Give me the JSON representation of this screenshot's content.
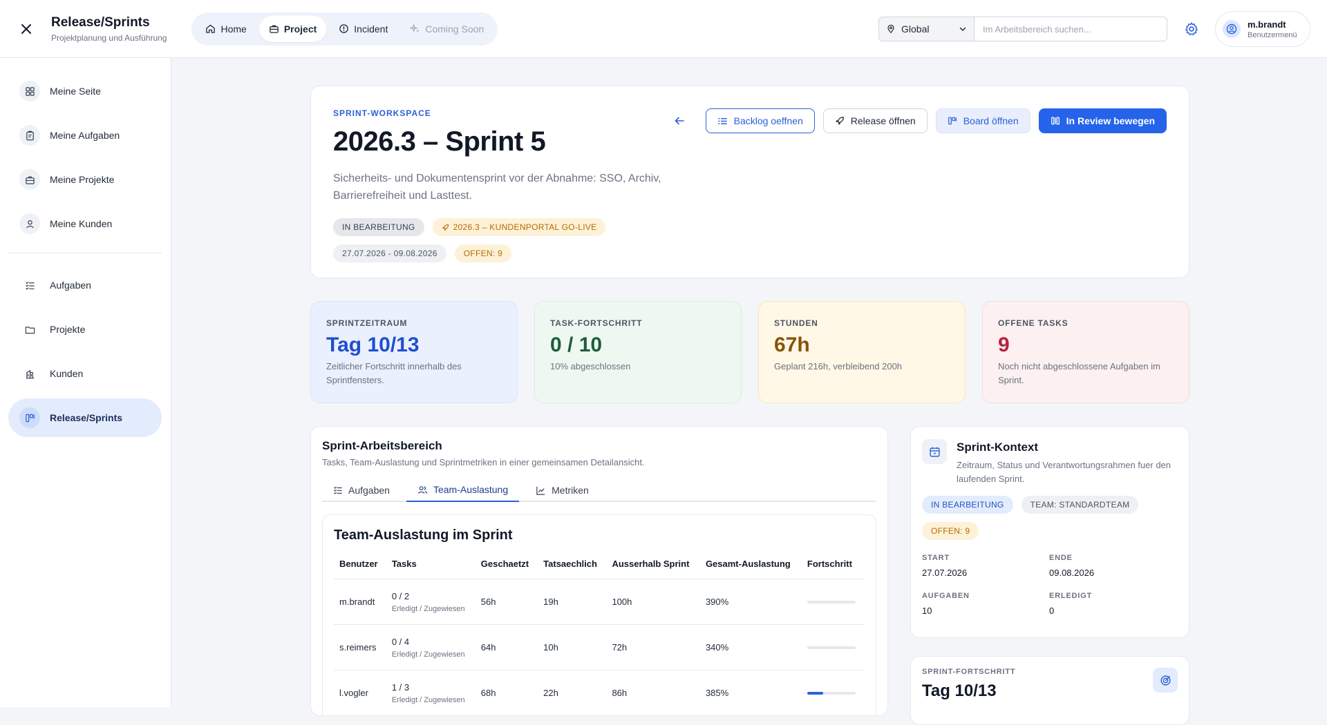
{
  "header": {
    "title": "Release/Sprints",
    "subtitle": "Projektplanung und Ausführung",
    "nav": [
      {
        "label": "Home"
      },
      {
        "label": "Project"
      },
      {
        "label": "Incident"
      },
      {
        "label": "Coming Soon"
      }
    ],
    "scope": "Global",
    "search_placeholder": "Im Arbeitsbereich suchen...",
    "user_name": "m.brandt",
    "user_sub": "Benutzermenü"
  },
  "sidebar": {
    "items": [
      {
        "label": "Meine Seite"
      },
      {
        "label": "Meine Aufgaben"
      },
      {
        "label": "Meine Projekte"
      },
      {
        "label": "Meine Kunden"
      },
      {
        "label": "Aufgaben"
      },
      {
        "label": "Projekte"
      },
      {
        "label": "Kunden"
      },
      {
        "label": "Release/Sprints"
      }
    ]
  },
  "hero": {
    "eyebrow": "SPRINT-WORKSPACE",
    "title": "2026.3 – Sprint 5",
    "description": "Sicherheits- und Dokumentensprint vor der Abnahme: SSO, Archiv, Barrierefreiheit und Lasttest.",
    "status": "IN BEARBEITUNG",
    "release": "2026.3 – KUNDENPORTAL GO-LIVE",
    "dates": "27.07.2026 - 09.08.2026",
    "open": "OFFEN: 9",
    "actions": {
      "backlog": "Backlog oeffnen",
      "release": "Release öffnen",
      "board": "Board öffnen",
      "review": "In Review bewegen"
    }
  },
  "stats": [
    {
      "label": "SPRINTZEITRAUM",
      "value": "Tag 10/13",
      "desc": "Zeitlicher Fortschritt innerhalb des Sprintfensters."
    },
    {
      "label": "TASK-FORTSCHRITT",
      "value": "0 / 10",
      "desc": "10% abgeschlossen"
    },
    {
      "label": "STUNDEN",
      "value": "67h",
      "desc": "Geplant 216h, verbleibend 200h"
    },
    {
      "label": "OFFENE TASKS",
      "value": "9",
      "desc": "Noch nicht abgeschlossene Aufgaben im Sprint."
    }
  ],
  "workarea": {
    "title": "Sprint-Arbeitsbereich",
    "subtitle": "Tasks, Team-Auslastung und Sprintmetriken in einer gemeinsamen Detailansicht.",
    "tabs": [
      {
        "label": "Aufgaben"
      },
      {
        "label": "Team-Auslastung"
      },
      {
        "label": "Metriken"
      }
    ],
    "table_title": "Team-Auslastung im Sprint",
    "columns": [
      "Benutzer",
      "Tasks",
      "Geschaetzt",
      "Tatsaechlich",
      "Ausserhalb Sprint",
      "Gesamt-Auslastung",
      "Fortschritt"
    ],
    "task_caption": "Erledigt / Zugewiesen",
    "rows": [
      {
        "user": "m.brandt",
        "tasks": "0 / 2",
        "est": "56h",
        "act": "19h",
        "outside": "100h",
        "total": "390%",
        "progress": 0
      },
      {
        "user": "s.reimers",
        "tasks": "0 / 4",
        "est": "64h",
        "act": "10h",
        "outside": "72h",
        "total": "340%",
        "progress": 0
      },
      {
        "user": "l.vogler",
        "tasks": "1 / 3",
        "est": "68h",
        "act": "22h",
        "outside": "86h",
        "total": "385%",
        "progress": 0.33
      }
    ]
  },
  "context": {
    "title": "Sprint-Kontext",
    "subtitle": "Zeitraum, Status und Verantwortungsrahmen fuer den laufenden Sprint.",
    "badges": {
      "status": "IN BEARBEITUNG",
      "team": "TEAM: STANDARDTEAM",
      "open": "OFFEN: 9"
    },
    "fields": [
      {
        "key": "START",
        "value": "27.07.2026"
      },
      {
        "key": "ENDE",
        "value": "09.08.2026"
      },
      {
        "key": "AUFGABEN",
        "value": "10"
      },
      {
        "key": "ERLEDIGT",
        "value": "0"
      }
    ]
  },
  "progress_card": {
    "label": "SPRINT-FORTSCHRITT",
    "value": "Tag 10/13"
  }
}
